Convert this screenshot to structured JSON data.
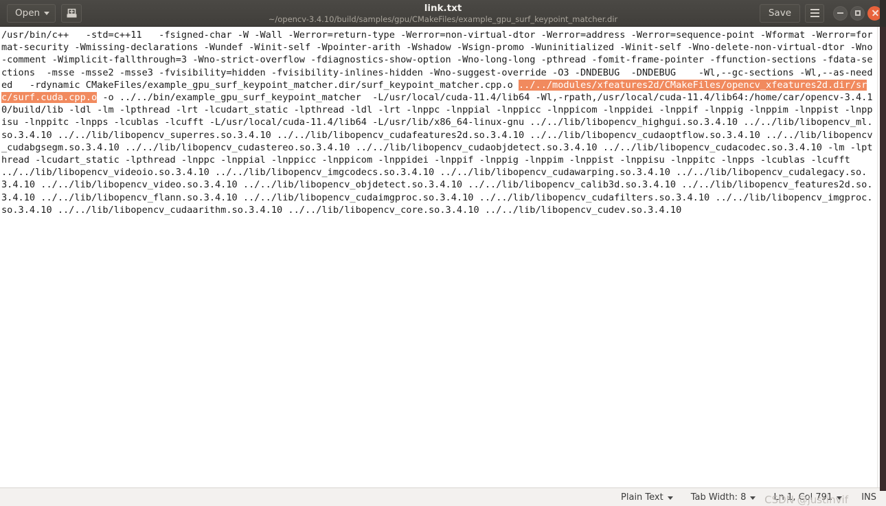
{
  "window": {
    "title": "link.txt",
    "subtitle": "~/opencv-3.4.10/build/samples/gpu/CMakeFiles/example_gpu_surf_keypoint_matcher.dir",
    "open_label": "Open",
    "save_label": "Save",
    "icons": {
      "open_caret": "chevron-down-icon",
      "new_document": "new-document-icon",
      "menu": "hamburger-menu-icon",
      "minimize": "minimize-icon",
      "maximize": "maximize-icon",
      "close": "close-icon"
    }
  },
  "colors": {
    "titlebar_bg": "#403e3a",
    "titlebar_text": "#f2f0ec",
    "subtitle_text": "#a9a49b",
    "close_button": "#e8633c",
    "selection_bg": "#f18a5e",
    "selection_fg": "#ffffff",
    "editor_bg": "#ffffff",
    "editor_fg": "#1b1b1b",
    "statusbar_bg": "#f3f1ef"
  },
  "editor": {
    "segments": [
      {
        "highlight": false,
        "text": "/usr/bin/c++   -std=c++11   -fsigned-char -W -Wall -Werror=return-type -Werror=non-virtual-dtor -Werror=address -Werror=sequence-point -Wformat -Werror=format-security -Wmissing-declarations -Wundef -Winit-self -Wpointer-arith -Wshadow -Wsign-promo -Wuninitialized -Winit-self -Wno-delete-non-virtual-dtor -Wno-comment -Wimplicit-fallthrough=3 -Wno-strict-overflow -fdiagnostics-show-option -Wno-long-long -pthread -fomit-frame-pointer -ffunction-sections -fdata-sections  -msse -msse2 -msse3 -fvisibility=hidden -fvisibility-inlines-hidden -Wno-suggest-override -O3 -DNDEBUG  -DNDEBUG    -Wl,--gc-sections -Wl,--as-needed   -rdynamic CMakeFiles/example_gpu_surf_keypoint_matcher.dir/surf_keypoint_matcher.cpp.o "
      },
      {
        "highlight": true,
        "text": "../../modules/xfeatures2d/CMakeFiles/opencv_xfeatures2d.dir/src/surf.cuda.cpp.o"
      },
      {
        "highlight": false,
        "text": " -o ../../bin/example_gpu_surf_keypoint_matcher  -L/usr/local/cuda-11.4/lib64 -Wl,-rpath,/usr/local/cuda-11.4/lib64:/home/car/opencv-3.4.10/build/lib -ldl -lm -lpthread -lrt -lcudart_static -lpthread -ldl -lrt -lnppc -lnppial -lnppicc -lnppicom -lnppidei -lnppif -lnppig -lnppim -lnppist -lnppisu -lnppitc -lnpps -lcublas -lcufft -L/usr/local/cuda-11.4/lib64 -L/usr/lib/x86_64-linux-gnu ../../lib/libopencv_highgui.so.3.4.10 ../../lib/libopencv_ml.so.3.4.10 ../../lib/libopencv_superres.so.3.4.10 ../../lib/libopencv_cudafeatures2d.so.3.4.10 ../../lib/libopencv_cudaoptflow.so.3.4.10 ../../lib/libopencv_cudabgsegm.so.3.4.10 ../../lib/libopencv_cudastereo.so.3.4.10 ../../lib/libopencv_cudaobjdetect.so.3.4.10 ../../lib/libopencv_cudacodec.so.3.4.10 -lm -lpthread -lcudart_static -lpthread -lnppc -lnppial -lnppicc -lnppicom -lnppidei -lnppif -lnppig -lnppim -lnppist -lnppisu -lnppitc -lnpps -lcublas -lcufft ../../lib/libopencv_videoio.so.3.4.10 ../../lib/libopencv_imgcodecs.so.3.4.10 ../../lib/libopencv_cudawarping.so.3.4.10 ../../lib/libopencv_cudalegacy.so.3.4.10 ../../lib/libopencv_video.so.3.4.10 ../../lib/libopencv_objdetect.so.3.4.10 ../../lib/libopencv_calib3d.so.3.4.10 ../../lib/libopencv_features2d.so.3.4.10 ../../lib/libopencv_flann.so.3.4.10 ../../lib/libopencv_cudaimgproc.so.3.4.10 ../../lib/libopencv_cudafilters.so.3.4.10 ../../lib/libopencv_imgproc.so.3.4.10 ../../lib/libopencv_cudaarithm.so.3.4.10 ../../lib/libopencv_core.so.3.4.10 ../../lib/libopencv_cudev.so.3.4.10"
      }
    ]
  },
  "statusbar": {
    "language": "Plain Text",
    "tab_width": "Tab Width: 8",
    "position": "Ln 1, Col 791",
    "insert_mode": "INS",
    "watermark": "CSDN @justinvif"
  }
}
